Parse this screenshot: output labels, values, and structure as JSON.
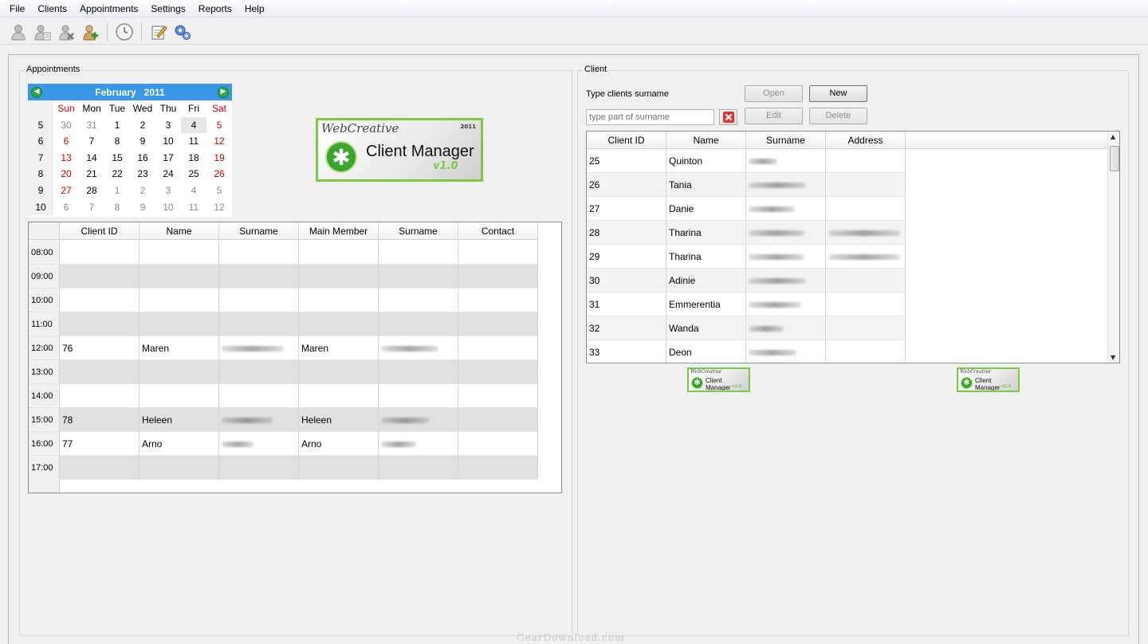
{
  "menu": [
    "File",
    "Clients",
    "Appointments",
    "Settings",
    "Reports",
    "Help"
  ],
  "toolbar": {
    "icons": [
      "user-icon",
      "edit-user-icon",
      "delete-user-icon",
      "add-user-icon",
      "clock-icon",
      "notes-icon",
      "settings-gears-icon"
    ]
  },
  "appointments": {
    "title": "Appointments",
    "calendar": {
      "month": "February",
      "year": "2011",
      "day_headers": [
        "Sun",
        "Mon",
        "Tue",
        "Wed",
        "Thu",
        "Fri",
        "Sat"
      ],
      "weeks": [
        {
          "week": "5",
          "days": [
            "30",
            "31",
            "1",
            "2",
            "3",
            "4",
            "5"
          ]
        },
        {
          "week": "6",
          "days": [
            "6",
            "7",
            "8",
            "9",
            "10",
            "11",
            "12"
          ]
        },
        {
          "week": "7",
          "days": [
            "13",
            "14",
            "15",
            "16",
            "17",
            "18",
            "19"
          ]
        },
        {
          "week": "8",
          "days": [
            "20",
            "21",
            "22",
            "23",
            "24",
            "25",
            "26"
          ]
        },
        {
          "week": "9",
          "days": [
            "27",
            "28",
            "1",
            "2",
            "3",
            "4",
            "5"
          ]
        },
        {
          "week": "10",
          "days": [
            "6",
            "7",
            "8",
            "9",
            "10",
            "11",
            "12"
          ]
        }
      ],
      "selected_day": "4"
    },
    "table": {
      "columns": [
        "Client ID",
        "Name",
        "Surname",
        "Main Member",
        "Surname",
        "Contact"
      ],
      "rows": [
        {
          "time": "08:00",
          "client_id": "",
          "name": "",
          "surname_blurred": false,
          "main_member": "",
          "mm_surname_blurred": false,
          "contact": ""
        },
        {
          "time": "09:00",
          "client_id": "",
          "name": "",
          "surname_blurred": false,
          "main_member": "",
          "mm_surname_blurred": false,
          "contact": ""
        },
        {
          "time": "10:00",
          "client_id": "",
          "name": "",
          "surname_blurred": false,
          "main_member": "",
          "mm_surname_blurred": false,
          "contact": ""
        },
        {
          "time": "11:00",
          "client_id": "",
          "name": "",
          "surname_blurred": false,
          "main_member": "",
          "mm_surname_blurred": false,
          "contact": ""
        },
        {
          "time": "12:00",
          "client_id": "76",
          "name": "Maren",
          "surname_blurred": true,
          "main_member": "Maren",
          "mm_surname_blurred": true,
          "contact": ""
        },
        {
          "time": "13:00",
          "client_id": "",
          "name": "",
          "surname_blurred": false,
          "main_member": "",
          "mm_surname_blurred": false,
          "contact": ""
        },
        {
          "time": "14:00",
          "client_id": "",
          "name": "",
          "surname_blurred": false,
          "main_member": "",
          "mm_surname_blurred": false,
          "contact": ""
        },
        {
          "time": "15:00",
          "client_id": "78",
          "name": "Heleen",
          "surname_blurred": true,
          "main_member": "Heleen",
          "mm_surname_blurred": true,
          "contact": ""
        },
        {
          "time": "16:00",
          "client_id": "77",
          "name": "Arno",
          "surname_blurred": true,
          "main_member": "Arno",
          "mm_surname_blurred": true,
          "contact": ""
        },
        {
          "time": "17:00",
          "client_id": "",
          "name": "",
          "surname_blurred": false,
          "main_member": "",
          "mm_surname_blurred": false,
          "contact": ""
        }
      ]
    }
  },
  "logo": {
    "brand": "WebCreative",
    "year": "2011",
    "product": "Client Manager",
    "version": "v1.0"
  },
  "client": {
    "title": "Client",
    "search_label": "Type clients surname",
    "search_placeholder": "type part of surname",
    "buttons": {
      "open": "Open",
      "new": "New",
      "edit": "Edit",
      "delete": "Delete"
    },
    "table": {
      "columns": [
        "Client ID",
        "Name",
        "Surname",
        "Address"
      ],
      "rows": [
        {
          "id": "25",
          "name": "Quinton",
          "has_address": false
        },
        {
          "id": "26",
          "name": "Tania",
          "has_address": false
        },
        {
          "id": "27",
          "name": "Danie",
          "has_address": false
        },
        {
          "id": "28",
          "name": "Tharina",
          "has_address": true
        },
        {
          "id": "29",
          "name": "Tharina",
          "has_address": true
        },
        {
          "id": "30",
          "name": "Adinie",
          "has_address": false
        },
        {
          "id": "31",
          "name": "Emmerentia",
          "has_address": false
        },
        {
          "id": "32",
          "name": "Wanda",
          "has_address": false
        },
        {
          "id": "33",
          "name": "Deon",
          "has_address": false
        }
      ]
    }
  },
  "watermark": "GearDownload.com",
  "colors": {
    "accent": "#3a97e6",
    "logo_green": "#7ac943",
    "weekend_red": "#cc0000"
  }
}
